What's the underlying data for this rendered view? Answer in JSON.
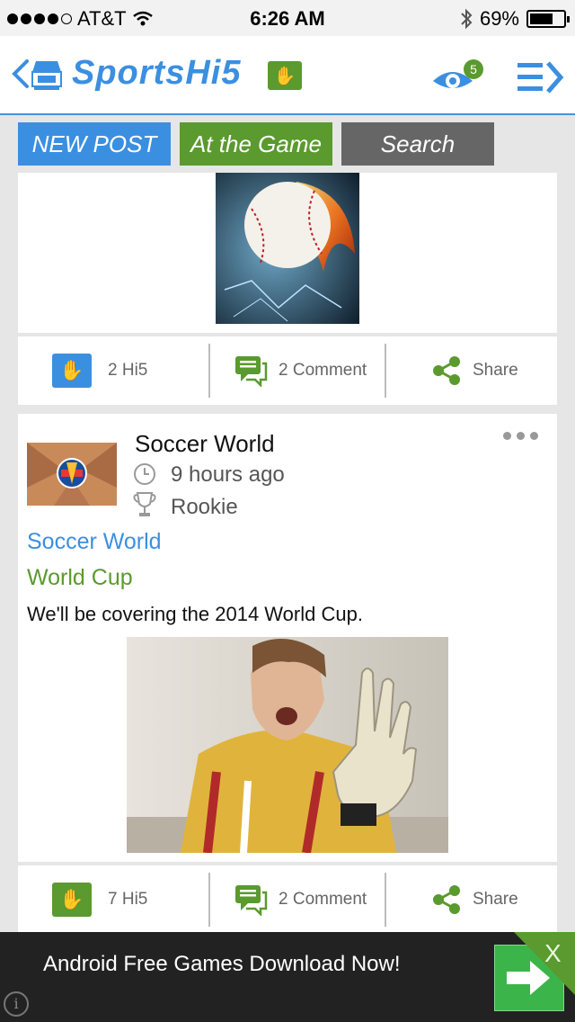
{
  "status_bar": {
    "carrier": "AT&T",
    "time": "6:26 AM",
    "battery_percent": "69%",
    "battery_level": 0.69
  },
  "nav": {
    "logo_text": "SportsHi5",
    "notification_count": "5"
  },
  "tabs": {
    "new_post": "NEW POST",
    "at_the_game": "At the Game",
    "search": "Search"
  },
  "post1_actions": {
    "hi5": "2 Hi5",
    "comments": "2 Comment",
    "share": "Share"
  },
  "post2": {
    "author": "Soccer World",
    "time_ago": "9 hours ago",
    "rank": "Rookie",
    "category": "Soccer World",
    "title": "World Cup",
    "body": "We'll be covering the 2014 World Cup."
  },
  "post2_actions": {
    "hi5": "7 Hi5",
    "comments": "2 Comment",
    "share": "Share"
  },
  "ad": {
    "text": "Android Free Games Download Now!",
    "close": "X",
    "info": "i"
  },
  "colors": {
    "brand_blue": "#3b8fe0",
    "brand_green": "#5a9a2e",
    "search_grey": "#666666"
  }
}
